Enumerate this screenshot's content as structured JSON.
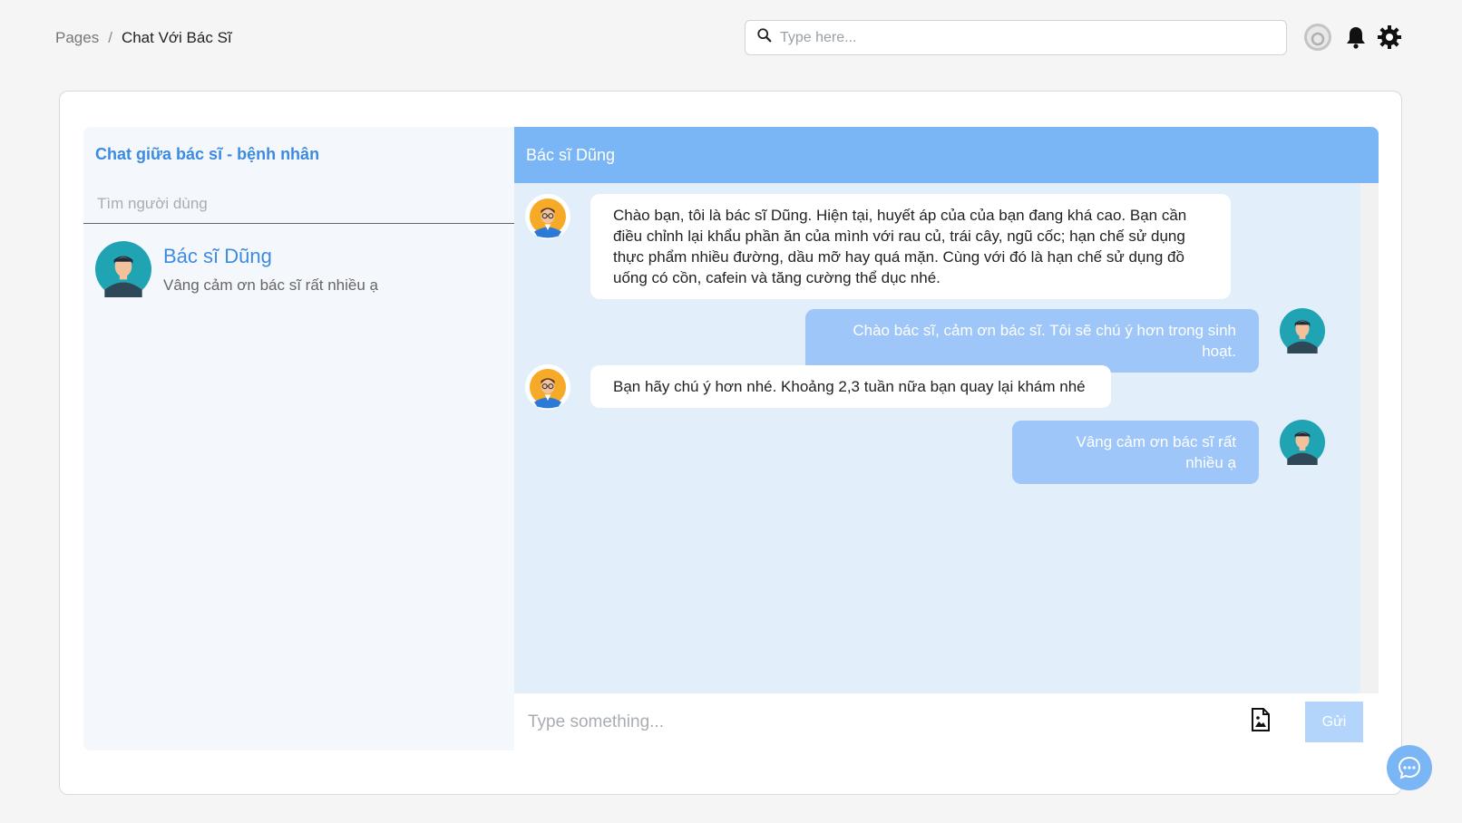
{
  "breadcrumb": {
    "root": "Pages",
    "separator": "/",
    "current": "Chat Với Bác Sĩ"
  },
  "search": {
    "placeholder": "Type here..."
  },
  "icons": {
    "search": "search-icon",
    "user": "user-circle-icon",
    "notifications": "bell-icon",
    "settings": "gear-icon",
    "attach": "image-file-icon",
    "chat_bubble": "chat-bubble-icon"
  },
  "sidebar": {
    "title": "Chat giữa bác sĩ - bệnh nhân",
    "search_placeholder": "Tìm người dùng",
    "contacts": [
      {
        "name": "Bác sĩ Dũng",
        "preview": "Vâng cảm ơn bác sĩ rất nhiều ạ"
      }
    ]
  },
  "chat": {
    "header": "Bác sĩ Dũng",
    "messages": [
      {
        "from": "doctor",
        "text": "Chào bạn, tôi là bác sĩ Dũng. Hiện tại, huyết áp của của bạn đang khá cao. Bạn cần điều chỉnh lại khẩu phần ăn của mình với rau củ, trái cây, ngũ cốc; hạn chế sử dụng thực phẩm nhiều đường, dầu mỡ hay quá mặn. Cùng với đó là hạn chế sử dụng đồ uống có cồn, cafein và tăng cường thể dục nhé."
      },
      {
        "from": "patient",
        "text": "Chào bác sĩ, cảm ơn bác sĩ. Tôi sẽ chú ý hơn trong sinh hoạt."
      },
      {
        "from": "doctor",
        "text": "Bạn hãy chú ý hơn nhé. Khoảng 2,3 tuần nữa bạn quay lại khám nhé"
      },
      {
        "from": "patient",
        "text": "Vâng cảm ơn bác sĩ rất nhiều ạ"
      }
    ],
    "input_placeholder": "Type something...",
    "send_label": "Gửi"
  },
  "colors": {
    "accent": "#3d8be0",
    "header": "#7ab6f5",
    "outgoing_bubble": "#9ec6f8",
    "chat_bg": "#e3eefb",
    "sidebar_bg": "#f4f8fc"
  }
}
